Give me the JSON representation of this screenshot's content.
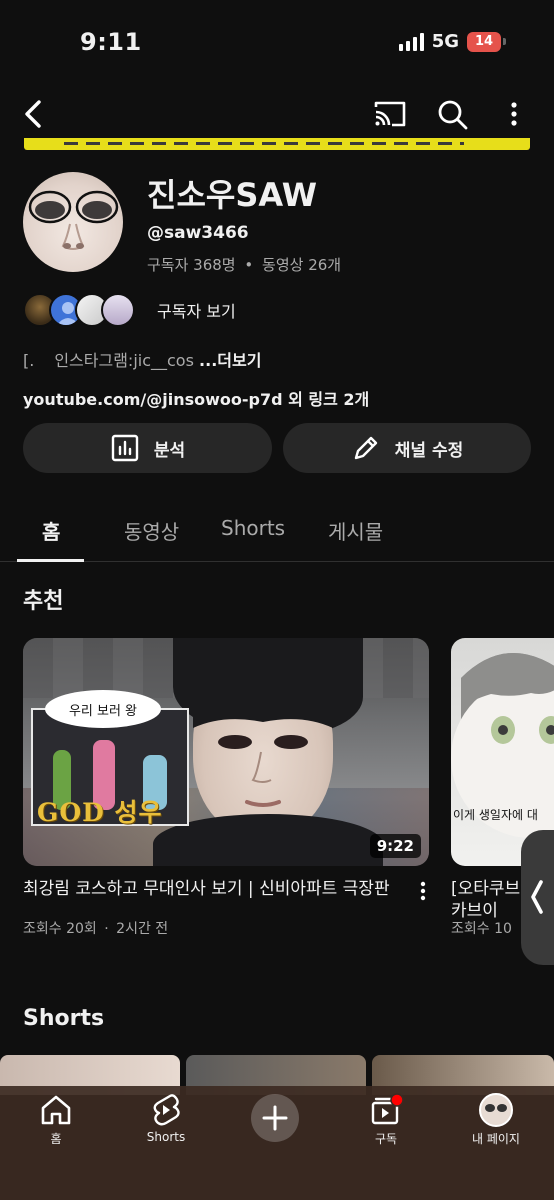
{
  "status_bar": {
    "time": "9:11",
    "network": "5G",
    "battery": "14"
  },
  "channel": {
    "name": "진소우SAW",
    "handle": "@saw3466",
    "subscribers": "구독자 368명",
    "separator": "•",
    "videos": "동영상 26개",
    "subscribers_link": "구독자 보기",
    "description_prefix": "[.",
    "description": "인스타그램:jic__cos",
    "more_label": "...더보기",
    "links": "youtube.com/@jinsowoo-p7d 외 링크 2개"
  },
  "buttons": {
    "analytics": "분석",
    "edit_channel": "채널 수정"
  },
  "tabs": [
    "홈",
    "동영상",
    "Shorts",
    "게시물"
  ],
  "recommended": {
    "title": "추천",
    "videos": [
      {
        "title": "최강림 코스하고 무대인사 보기 | 신비아파트 극장판",
        "views": "조회수 20회",
        "dot": "·",
        "age": "2시간 전",
        "duration": "9:22",
        "thumb_bubble": "우리 보러 왕",
        "thumb_caption": "GOD 성우"
      },
      {
        "title": "[오타쿠브이 생카브이",
        "views": "조회수 10",
        "thumb_caption": "이게 생일자에 대"
      }
    ]
  },
  "shorts_section": {
    "title": "Shorts"
  },
  "bottom_nav": {
    "home": "홈",
    "shorts": "Shorts",
    "subscriptions": "구독",
    "you": "내 페이지"
  },
  "colors": {
    "background": "#0f0f0f",
    "surface": "#272727",
    "accent_red": "#ff0000",
    "battery_red": "#e5534b",
    "banner_yellow": "#e7de1a"
  }
}
